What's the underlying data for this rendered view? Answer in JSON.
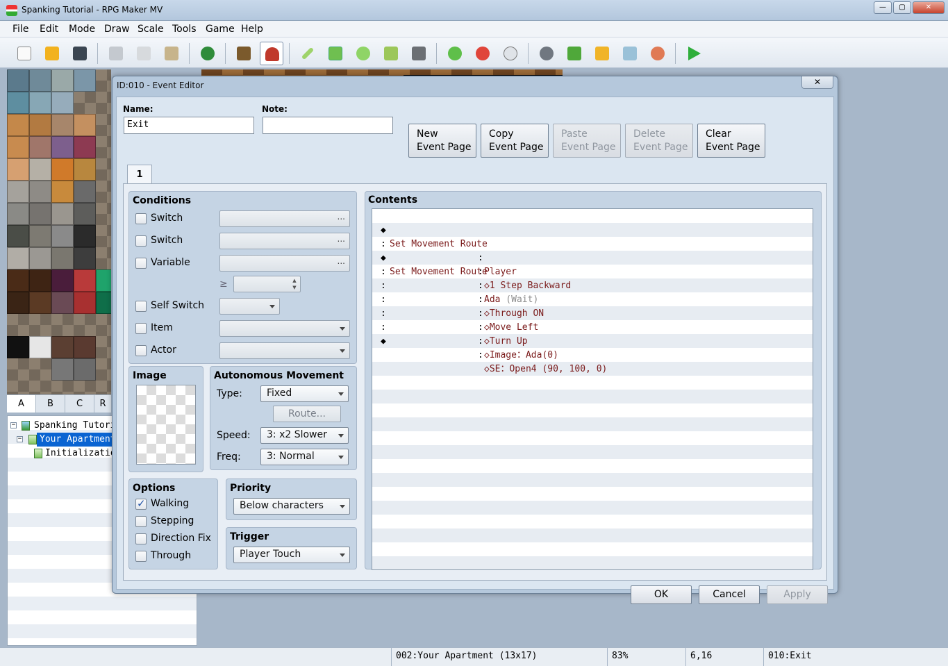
{
  "window": {
    "title": "Spanking Tutorial - RPG Maker MV"
  },
  "menu": [
    "File",
    "Edit",
    "Mode",
    "Draw",
    "Scale",
    "Tools",
    "Game",
    "Help"
  ],
  "toolbar_icons": [
    "new-project-icon",
    "open-project-icon",
    "save-project-icon",
    "cut-icon",
    "copy-icon",
    "paste-icon",
    "undo-icon",
    "map-mode-icon",
    "event-mode-icon",
    "pencil-icon",
    "rectangle-icon",
    "ellipse-icon",
    "fill-icon",
    "shadow-pen-icon",
    "zoom-in-icon",
    "zoom-out-icon",
    "actual-size-icon",
    "database-icon",
    "plugin-manager-icon",
    "sound-test-icon",
    "event-searcher-icon",
    "character-generator-icon",
    "playtest-icon"
  ],
  "tileset_tabs": [
    "A",
    "B",
    "C",
    "R"
  ],
  "map_tree": {
    "root": "Spanking Tutorial",
    "maps": [
      "Your Apartment",
      "Initialization"
    ]
  },
  "status": {
    "map": "002:Your Apartment (13x17)",
    "zoom": "83%",
    "coords": "6,16",
    "event": "010:Exit"
  },
  "dialog": {
    "title": "ID:010 - Event Editor",
    "close": "✕",
    "name_label": "Name:",
    "name_value": "Exit",
    "note_label": "Note:",
    "note_value": "",
    "page_buttons": [
      {
        "label": "New\nEvent Page",
        "enabled": true
      },
      {
        "label": "Copy\nEvent Page",
        "enabled": true
      },
      {
        "label": "Paste\nEvent Page",
        "enabled": false
      },
      {
        "label": "Delete\nEvent Page",
        "enabled": false
      },
      {
        "label": "Clear\nEvent Page",
        "enabled": true
      }
    ],
    "page_tab": "1",
    "conditions": {
      "title": "Conditions",
      "switch1": "Switch",
      "switch2": "Switch",
      "variable": "Variable",
      "ge": "≥",
      "self_switch": "Self Switch",
      "item": "Item",
      "actor": "Actor",
      "dots": "..."
    },
    "image": {
      "title": "Image"
    },
    "autonomous": {
      "title": "Autonomous Movement",
      "type_label": "Type:",
      "type_value": "Fixed",
      "route_button": "Route...",
      "speed_label": "Speed:",
      "speed_value": "3: x2 Slower",
      "freq_label": "Freq:",
      "freq_value": "3: Normal"
    },
    "options": {
      "title": "Options",
      "walking": "Walking",
      "stepping": "Stepping",
      "direction_fix": "Direction Fix",
      "through": "Through",
      "walking_checked": true
    },
    "priority": {
      "title": "Priority",
      "value": "Below characters"
    },
    "trigger": {
      "title": "Trigger",
      "value": "Player Touch"
    },
    "contents": {
      "title": "Contents",
      "lines": [
        {
          "mark": "◆",
          "main": "Set Movement Route",
          "colon": ":",
          "val": "Player",
          "wait": ""
        },
        {
          "mark": ":",
          "main": "",
          "colon": ":",
          "val": "◇1 Step Backward",
          "wait": ""
        },
        {
          "mark": "◆",
          "main": "Set Movement Route",
          "colon": ":",
          "val": "Ada",
          "wait": " (Wait)"
        },
        {
          "mark": ":",
          "main": "",
          "colon": ":",
          "val": "◇Through ON",
          "wait": ""
        },
        {
          "mark": ":",
          "main": "",
          "colon": ":",
          "val": "◇Move Left",
          "wait": ""
        },
        {
          "mark": ":",
          "main": "",
          "colon": ":",
          "val": "◇Turn Up",
          "wait": ""
        },
        {
          "mark": ":",
          "main": "",
          "colon": ":",
          "val": "◇Image：Ada(0)",
          "wait": ""
        },
        {
          "mark": ":",
          "main": "",
          "colon": ":",
          "val": "◇SE：Open4 (90, 100, 0)",
          "wait": ""
        },
        {
          "mark": "◆",
          "main": "",
          "colon": "",
          "val": "",
          "wait": ""
        }
      ]
    },
    "footer": {
      "ok": "OK",
      "cancel": "Cancel",
      "apply": "Apply"
    }
  }
}
